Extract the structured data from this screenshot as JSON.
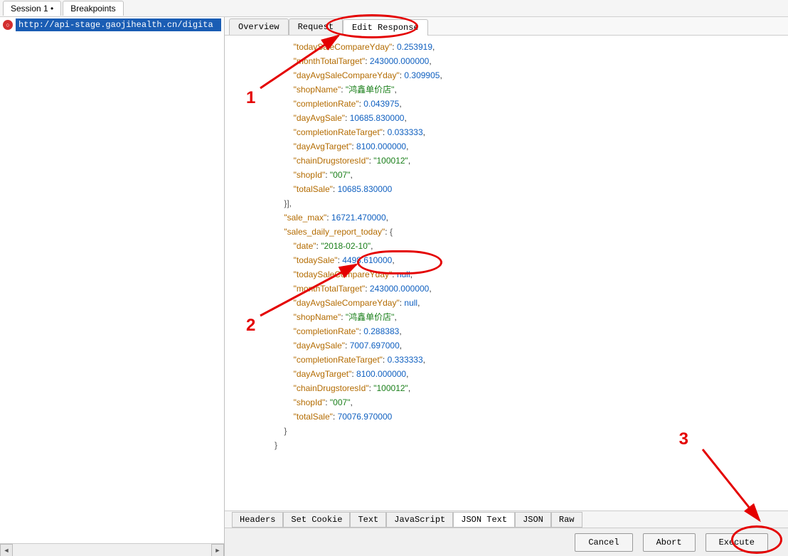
{
  "top_tabs": {
    "session": "Session 1 •",
    "breakpoints": "Breakpoints"
  },
  "left": {
    "url": "http://api-stage.gaojihealth.cn/digita"
  },
  "inner_tabs": {
    "overview": "Overview",
    "request": "Request",
    "edit_response": "Edit Response"
  },
  "code": {
    "l1_k": "\"todaySaleCompareYday\"",
    "l1_v": "0.253919",
    "l2_k": "\"monthTotalTarget\"",
    "l2_v": "243000.000000",
    "l3_k": "\"dayAvgSaleCompareYday\"",
    "l3_v": "0.309905",
    "l4_k": "\"shopName\"",
    "l4_v": "\"鸿鑫单价店\"",
    "l5_k": "\"completionRate\"",
    "l5_v": "0.043975",
    "l6_k": "\"dayAvgSale\"",
    "l6_v": "10685.830000",
    "l7_k": "\"completionRateTarget\"",
    "l7_v": "0.033333",
    "l8_k": "\"dayAvgTarget\"",
    "l8_v": "8100.000000",
    "l9_k": "\"chainDrugstoresId\"",
    "l9_v": "\"100012\"",
    "l10_k": "\"shopId\"",
    "l10_v": "\"007\"",
    "l11_k": "\"totalSale\"",
    "l11_v": "10685.830000",
    "l12": "}],",
    "l13_k": "\"sale_max\"",
    "l13_v": "16721.470000",
    "l14_k": "\"sales_daily_report_today\"",
    "l14_v": "{",
    "l15_k": "\"date\"",
    "l15_v": "\"2018-02-10\"",
    "l16_k": "\"todaySale\"",
    "l16_v": "4498.610000",
    "l17_k": "\"todaySaleCompareYday\"",
    "l17_v": "null",
    "l18_k": "\"monthTotalTarget\"",
    "l18_v": "243000.000000",
    "l19_k": "\"dayAvgSaleCompareYday\"",
    "l19_v": "null",
    "l20_k": "\"shopName\"",
    "l20_v": "\"鸿鑫单价店\"",
    "l21_k": "\"completionRate\"",
    "l21_v": "0.288383",
    "l22_k": "\"dayAvgSale\"",
    "l22_v": "7007.697000",
    "l23_k": "\"completionRateTarget\"",
    "l23_v": "0.333333",
    "l24_k": "\"dayAvgTarget\"",
    "l24_v": "8100.000000",
    "l25_k": "\"chainDrugstoresId\"",
    "l25_v": "\"100012\"",
    "l26_k": "\"shopId\"",
    "l26_v": "\"007\"",
    "l27_k": "\"totalSale\"",
    "l27_v": "70076.970000",
    "l28": "}",
    "l29": "}"
  },
  "bottom_tabs": {
    "headers": "Headers",
    "set_cookie": "Set Cookie",
    "text": "Text",
    "javascript": "JavaScript",
    "json_text": "JSON Text",
    "json": "JSON",
    "raw": "Raw"
  },
  "buttons": {
    "cancel": "Cancel",
    "abort": "Abort",
    "execute": "Execute"
  },
  "annotations": {
    "n1": "1",
    "n2": "2",
    "n3": "3"
  }
}
